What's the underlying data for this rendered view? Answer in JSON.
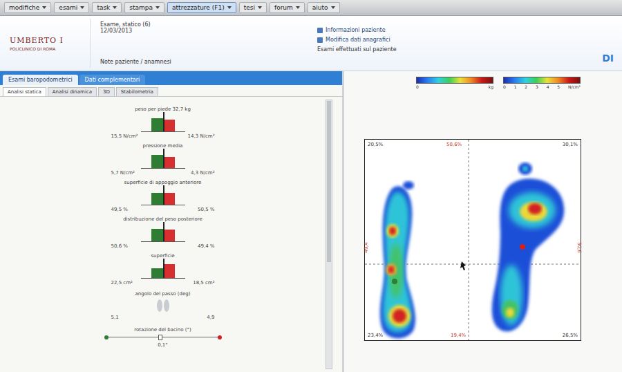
{
  "menu": [
    {
      "label": "modifiche",
      "selected": false
    },
    {
      "label": "esami",
      "selected": false
    },
    {
      "label": "task",
      "selected": false
    },
    {
      "label": "stampa",
      "selected": false
    },
    {
      "label": "attrezzature (F1)",
      "selected": true
    },
    {
      "label": "tesi",
      "selected": false
    },
    {
      "label": "forum",
      "selected": false
    },
    {
      "label": "aiuto",
      "selected": false
    }
  ],
  "logo": {
    "name": "UMBERTO I",
    "subtitle": "POLICLINICO DI ROMA"
  },
  "patient": {
    "lines": [
      "Esame, statico (6)",
      "12/03/2013"
    ],
    "note": "Note paziente / anamnesi"
  },
  "links": [
    {
      "label": "Informazioni paziente"
    },
    {
      "label": "Modifica dati anagrafici"
    }
  ],
  "footer_note": "Esami effettuati sul paziente",
  "brand": "DI",
  "tabs": [
    {
      "label": "Esami baropodometrici",
      "selected": true
    },
    {
      "label": "Dati complementari",
      "selected": false
    }
  ],
  "subtabs": [
    {
      "label": "Analisi statica",
      "selected": true
    },
    {
      "label": "Analisi dinamica",
      "selected": false
    },
    {
      "label": "3D",
      "selected": false
    },
    {
      "label": "Stabilometria",
      "selected": false
    }
  ],
  "metrics": [
    {
      "label": "peso per piede 32,7 kg",
      "left": {
        "level": 0.78,
        "reading": "15,5 N/cm²"
      },
      "right": {
        "level": 0.72,
        "reading": "14,3 N/cm²"
      }
    },
    {
      "label": "pressione media",
      "left": {
        "level": 0.8,
        "reading": "5,7 N/cm²"
      },
      "right": {
        "level": 0.66,
        "reading": "4,3 N/cm²"
      }
    },
    {
      "label": "superficie di appoggio anteriore",
      "left": {
        "level": 0.7,
        "reading": "49,5 %"
      },
      "right": {
        "level": 0.72,
        "reading": "50,5 %"
      }
    },
    {
      "label": "distribuzione del peso posteriore",
      "left": {
        "level": 0.74,
        "reading": "50,6 %"
      },
      "right": {
        "level": 0.72,
        "reading": "49,4 %"
      }
    },
    {
      "label": "superficie",
      "left": {
        "level": 0.6,
        "reading": "22,5 cm²"
      },
      "right": {
        "level": 0.82,
        "reading": "18,5 cm²"
      }
    }
  ],
  "angle_label": "angolo del passo (deg)",
  "foot_readings": [
    "5,1",
    "4,9"
  ],
  "slider": {
    "label": "rotazione del bacino (°)",
    "level": 0.48,
    "reading": "0,1°"
  },
  "scales": [
    {
      "ticks": [
        "0"
      ],
      "unit": "kg"
    },
    {
      "ticks": [
        "0",
        "1",
        "2",
        "3",
        "4",
        "5"
      ],
      "unit": "N/cm²"
    }
  ],
  "plot": {
    "top_left": "20,5%",
    "top_center": "50,6%",
    "top_right": "30,1%",
    "bottom_left": "23,4%",
    "bottom_center": "19,4%",
    "bottom_right": "26,5%",
    "side_left": "49,4",
    "side_right": "50,6"
  }
}
